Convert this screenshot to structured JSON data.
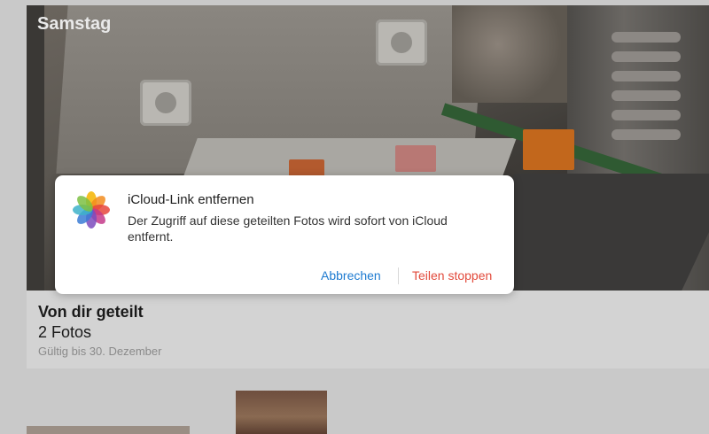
{
  "album": {
    "day_label": "Samstag",
    "title": "Von dir geteilt",
    "count": "2 Fotos",
    "valid_until": "Gültig bis 30. Dezember"
  },
  "dialog": {
    "icon": "photos-app-icon",
    "title": "iCloud-Link entfernen",
    "message": "Der Zugriff auf diese geteilten Fotos wird sofort von iCloud entfernt.",
    "cancel_label": "Abbrechen",
    "confirm_label": "Teilen stoppen",
    "colors": {
      "cancel": "#1d7ad0",
      "destructive": "#e24a3b"
    }
  }
}
